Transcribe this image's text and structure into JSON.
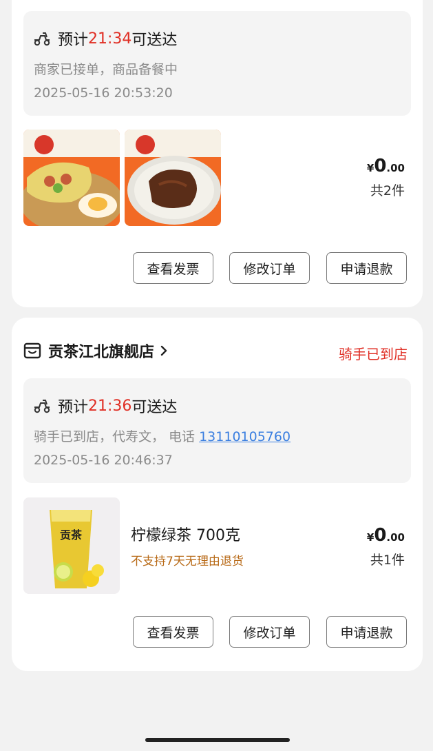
{
  "orders": [
    {
      "eta_prefix": "预计",
      "eta_time": "21:34",
      "eta_suffix": "可送达",
      "status_text": "商家已接单，商品备餐中",
      "timestamp": "2025-05-16 20:53:20",
      "price_symbol": "¥",
      "price_int": "0",
      "price_dec": ".00",
      "quantity": "共2件",
      "buttons": [
        "查看发票",
        "修改订单",
        "申请退款"
      ]
    },
    {
      "shop_name": "贡茶江北旗舰店",
      "shop_status": "骑手已到店",
      "eta_prefix": "预计",
      "eta_time": "21:36",
      "eta_suffix": "可送达",
      "status_text": "骑手已到店，代寿文， 电话 ",
      "phone": "13110105760",
      "timestamp": "2025-05-16 20:46:37",
      "product_name": "柠檬绿茶 700克",
      "product_note": "不支持7天无理由退货",
      "product_logo_text": "贡茶",
      "price_symbol": "¥",
      "price_int": "0",
      "price_dec": ".00",
      "quantity": "共1件",
      "buttons": [
        "查看发票",
        "修改订单",
        "申请退款"
      ]
    }
  ],
  "colors": {
    "accent_red": "#e02e24",
    "link_blue": "#3b7fe0",
    "note_orange": "#b86a17"
  },
  "icons": {
    "delivery": "scooter-icon",
    "shop": "shop-icon",
    "chevron": "chevron-right-icon"
  }
}
